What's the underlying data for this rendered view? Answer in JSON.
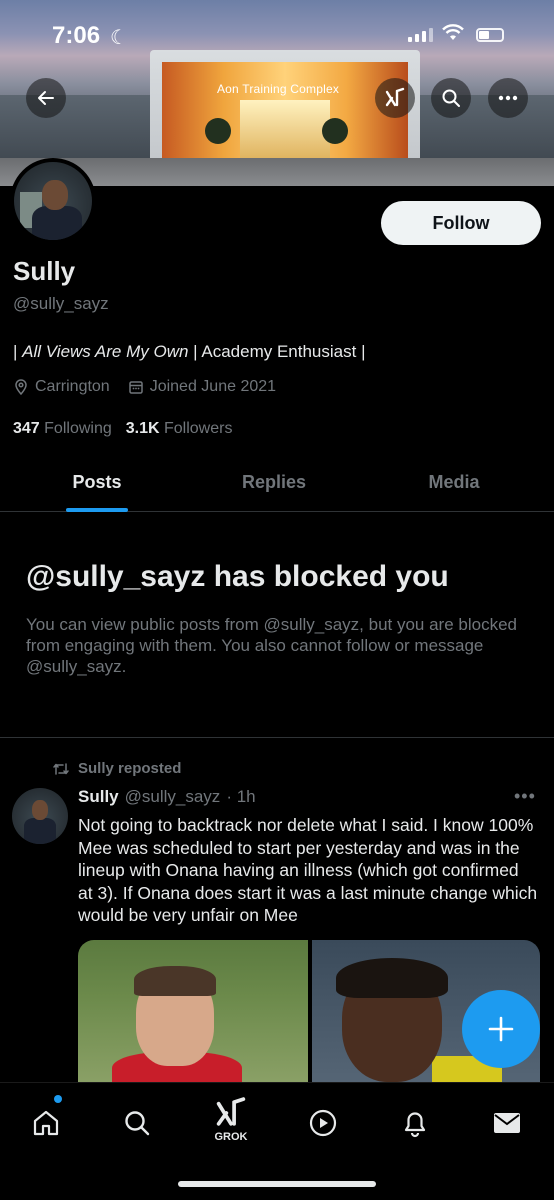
{
  "status_bar": {
    "time": "7:06"
  },
  "banner": {
    "sign_text": "Aon Training Complex"
  },
  "profile": {
    "name": "Sully",
    "handle": "@sully_sayz",
    "follow_label": "Follow",
    "bio_italic": "All Views Are My Own",
    "bio_rest": "Academy Enthusiast |",
    "bio_prefix": "|",
    "bio_sep": "|",
    "location": "Carrington",
    "joined": "Joined June 2021",
    "following_count": "347",
    "following_label": "Following",
    "followers_count": "3.1K",
    "followers_label": "Followers"
  },
  "tabs": [
    {
      "label": "Posts",
      "active": true
    },
    {
      "label": "Replies",
      "active": false
    },
    {
      "label": "Media",
      "active": false
    }
  ],
  "blocked": {
    "title": "@sully_sayz has blocked you",
    "message": "You can view public posts from @sully_sayz, but you are blocked from engaging with them. You also cannot follow or message @sully_sayz."
  },
  "post": {
    "repost_label": "Sully reposted",
    "author": "Sully",
    "handle": "@sully_sayz",
    "time": "· 1h",
    "text": "Not going to backtrack nor delete what I said. I know 100% Mee was scheduled to start per yesterday and was in the lineup with Onana having an illness (which got confirmed at 3). If Onana does start it was a last minute change which would be very unfair on Mee"
  },
  "bottom_nav": {
    "grok_label": "GROK"
  },
  "colors": {
    "accent": "#1d9bf0",
    "text_primary": "#e7e9ea",
    "text_secondary": "#71767b",
    "background": "#000000"
  }
}
